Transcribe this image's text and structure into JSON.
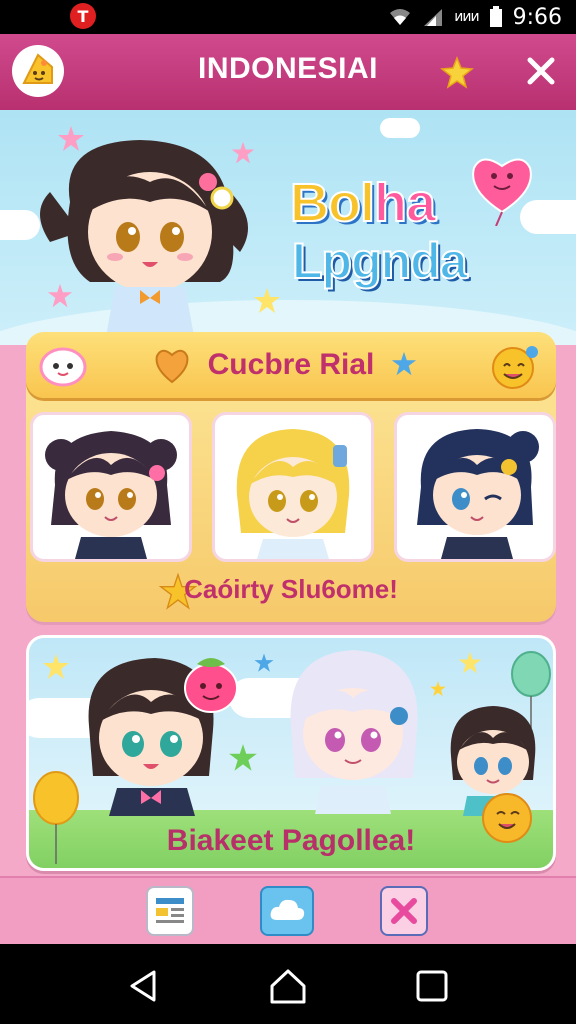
{
  "status_bar": {
    "app_icon_letter": "T",
    "time": "9:66",
    "battery_label": "ᴎᴎᴎ",
    "icons": [
      "wifi-icon",
      "signal-icon",
      "battery-icon"
    ]
  },
  "header": {
    "title": "INDONESIAI",
    "logo_icon": "cheese-mascot-icon",
    "star_icon": "star-icon",
    "close_icon": "close-icon",
    "background": "#c13a7c"
  },
  "hero": {
    "title_line1_part1": "Bol",
    "title_line1_part2": "ha",
    "title_line2": "Lpgnda"
  },
  "section1": {
    "banner_title": "Cucbre Rial",
    "caption": "Caóirty Slu6ome!",
    "cards": [
      {
        "hair": "#3a2a3e",
        "accent": "#ff6fa6"
      },
      {
        "hair": "#f5d24a",
        "accent": "#6fa8dc"
      },
      {
        "hair": "#23325c",
        "accent": "#f2c230"
      }
    ]
  },
  "section2": {
    "caption": "Biakeet Pagollea!"
  },
  "toolbar": {
    "buttons": [
      "news-icon",
      "cloud-document-icon",
      "cancel-icon"
    ]
  },
  "navbar": {
    "buttons": [
      "back-icon",
      "home-icon",
      "recents-icon"
    ]
  },
  "colors": {
    "accent_pink": "#c13a7c",
    "banner_yellow": "#f9c54f",
    "sky_blue": "#aee3f4"
  }
}
